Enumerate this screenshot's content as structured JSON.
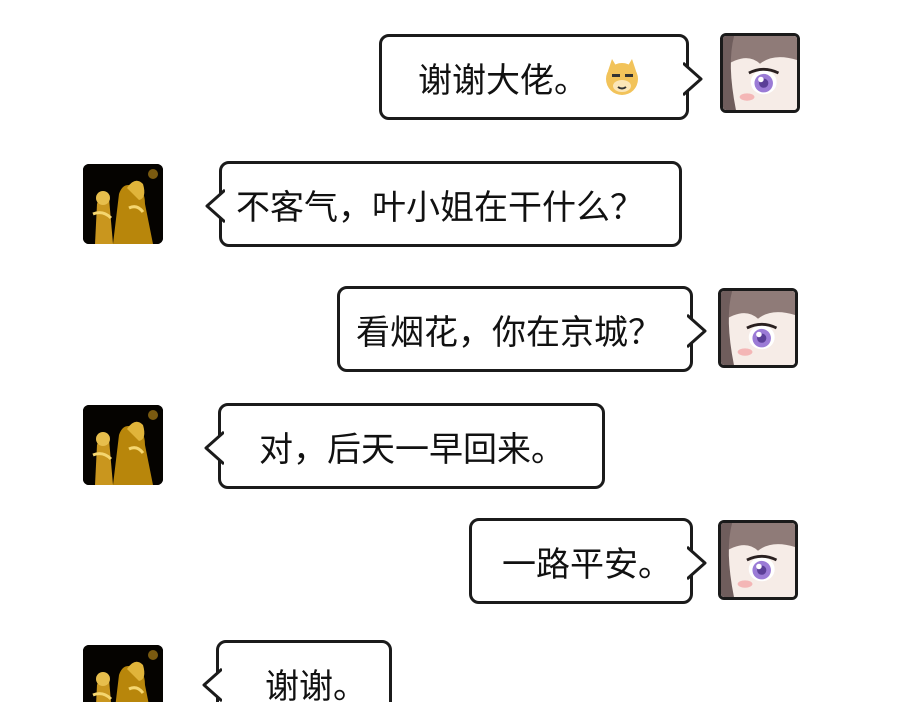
{
  "messages": [
    {
      "side": "right",
      "speaker": "girl",
      "text": "谢谢大佬。",
      "emoji": "doge-emoji"
    },
    {
      "side": "left",
      "speaker": "gold",
      "text": "不客气，叶小姐在干什么？"
    },
    {
      "side": "right",
      "speaker": "girl",
      "text": "看烟花，你在京城？"
    },
    {
      "side": "left",
      "speaker": "gold",
      "text": "对，后天一早回来。"
    },
    {
      "side": "right",
      "speaker": "girl",
      "text": "一路平安。"
    },
    {
      "side": "left",
      "speaker": "gold",
      "text": "谢谢。"
    }
  ],
  "colors": {
    "bubble_border": "#1b1b1b",
    "gold_avatar": "#d4a21a",
    "girl_eye": "#9b7bd6"
  }
}
